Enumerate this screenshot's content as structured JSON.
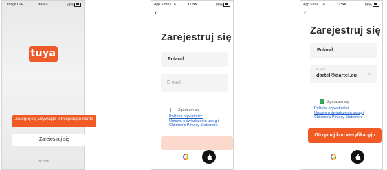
{
  "screen1": {
    "status": {
      "carrier": "Orange LTE",
      "time": "16:03",
      "battery": "61%"
    },
    "logo": "tuya",
    "login_button": "Zaloguj się używając istniejącego konta",
    "register_button": "Zarejestruj się",
    "try_now": "Try now"
  },
  "screen2": {
    "status": {
      "carrier": "App Store LTE",
      "time": "11:55",
      "battery": "85%"
    },
    "title": "Zarejestruj się",
    "country": "Poland",
    "email_placeholder": "E-mail",
    "consent": "Zgadzam się",
    "consent_checked": false,
    "links": [
      "Polityka prywatności",
      "Umowa o świadczeniu usług i",
      "Children's Privacy Statement"
    ]
  },
  "screen3": {
    "status": {
      "carrier": "App Store LTE",
      "time": "11:56",
      "battery": "85%"
    },
    "title": "Zarejestruj się",
    "country": "Poland",
    "email_label": "E-mail",
    "email_value": "dartel@dartel.eu",
    "consent": "Zgadzam się",
    "consent_checked": true,
    "links": [
      "Polityka prywatności",
      "Umowa o świadczeniu usług i",
      "Children's Privacy Statement"
    ],
    "submit": "Otrzymaj kod weryfikacyjn"
  },
  "colors": {
    "brand": "#f15a24",
    "link": "#1a5ecb",
    "checkbox": "#2fa34a"
  },
  "icons": {
    "back": "chevron-left-icon",
    "google": "google-icon",
    "apple": "apple-icon"
  }
}
